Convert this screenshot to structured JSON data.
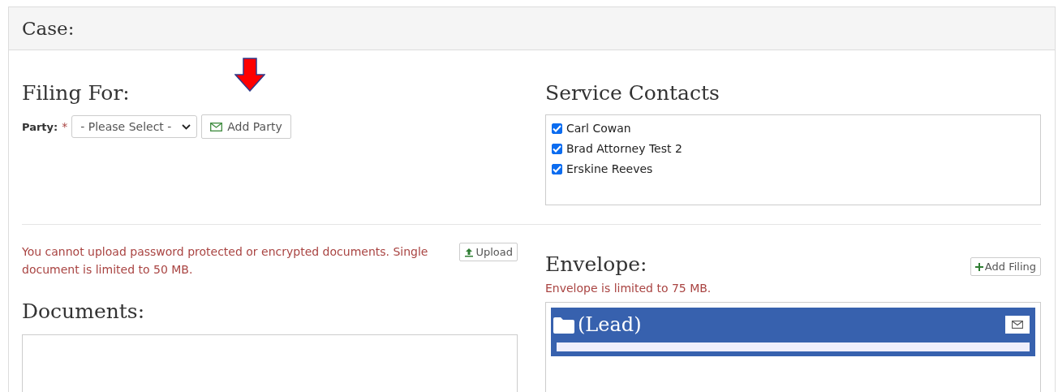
{
  "panel": {
    "title": "Case:"
  },
  "filing_for": {
    "heading": "Filing For:",
    "party_label": "Party:",
    "required_mark": "*",
    "party_select": {
      "value": "- Please Select -"
    },
    "add_party_button": "Add Party"
  },
  "service_contacts": {
    "heading": "Service Contacts",
    "contacts": [
      {
        "name": "Carl Cowan",
        "checked": true
      },
      {
        "name": "Brad Attorney Test 2",
        "checked": true
      },
      {
        "name": "Erskine Reeves",
        "checked": true
      }
    ]
  },
  "upload": {
    "notice": "You cannot upload password protected or encrypted documents. Single document is limited to 50 MB.",
    "button": "Upload"
  },
  "documents": {
    "heading": "Documents:"
  },
  "envelope": {
    "heading": "Envelope:",
    "add_filing_button": "Add Filing",
    "notice": "Envelope is limited to 75 MB.",
    "filing": {
      "title": "(Lead)"
    }
  }
}
